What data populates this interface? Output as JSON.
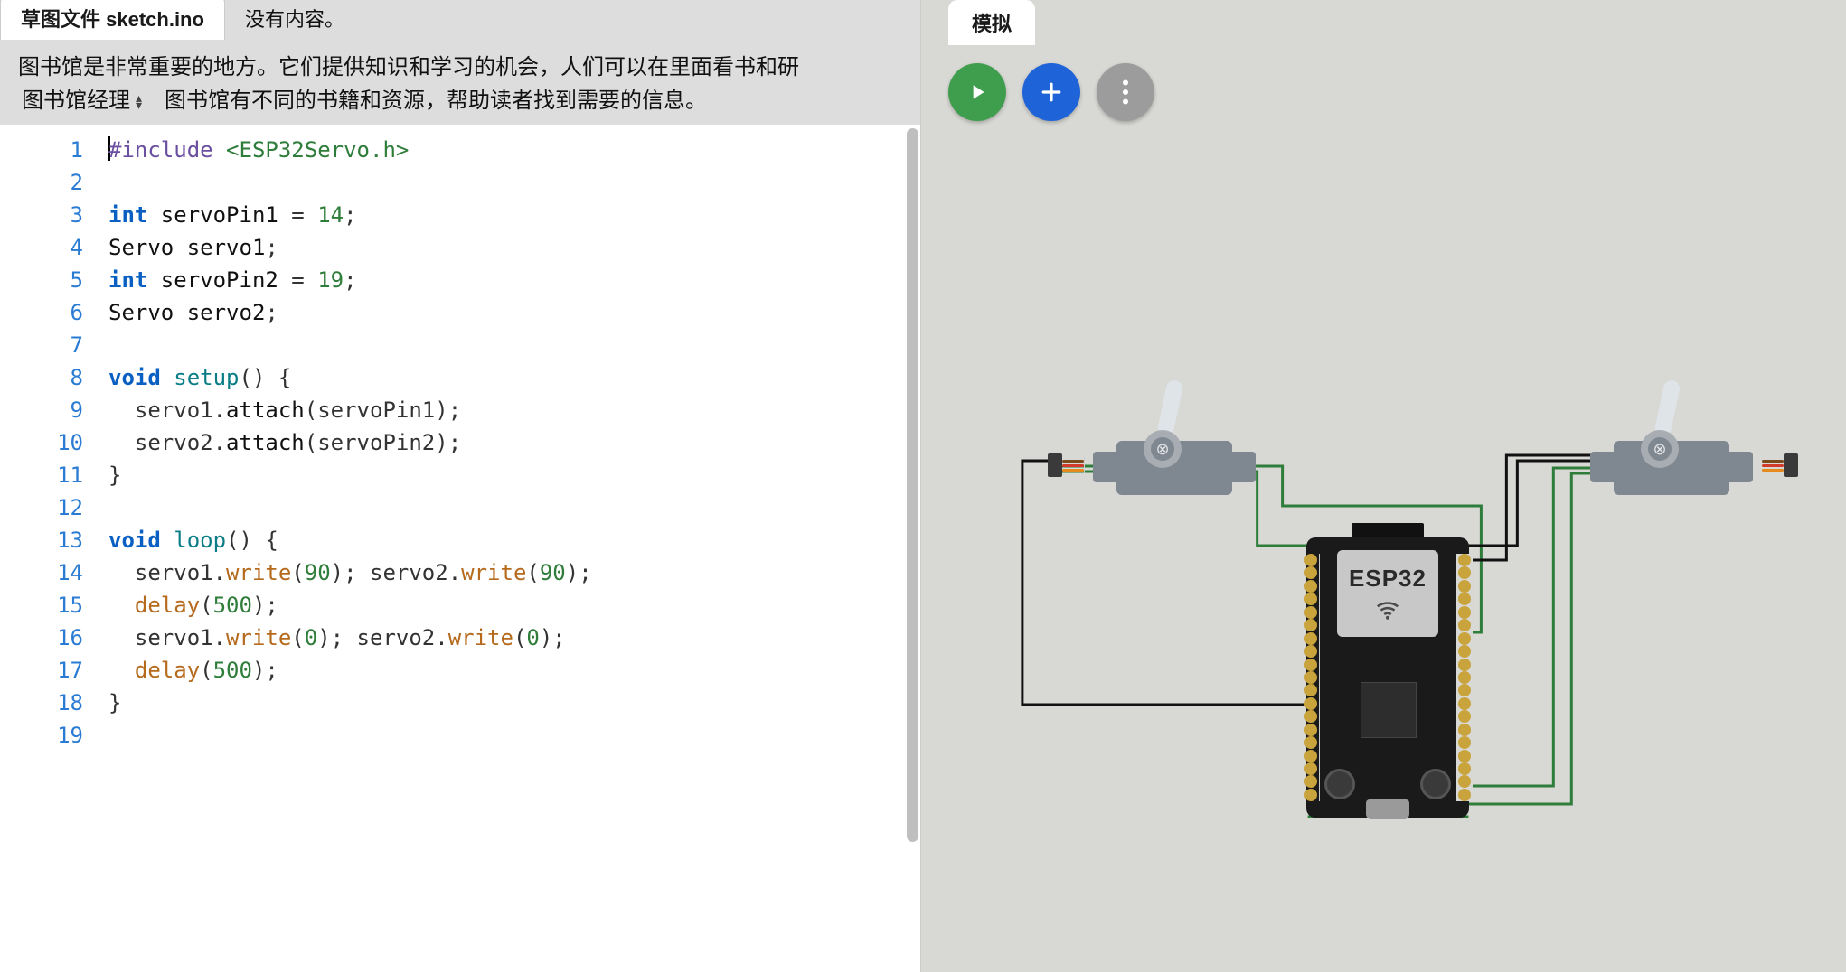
{
  "tabs": {
    "sketch_prefix": "草图文件 ",
    "sketch_filename": "sketch.ino",
    "empty_label": "没有内容。"
  },
  "description": {
    "line1": "图书馆是非常重要的地方。它们提供知识和学习的机会，人们可以在里面看书和研",
    "select_label": "图书馆经理",
    "line2_rest": "图书馆有不同的书籍和资源，帮助读者找到需要的信息。"
  },
  "editor": {
    "line_count": 19,
    "code_lines": [
      {
        "n": 1,
        "tokens": [
          [
            "pp",
            "#include "
          ],
          [
            "incstr",
            "<ESP32Servo.h>"
          ]
        ]
      },
      {
        "n": 2,
        "tokens": []
      },
      {
        "n": 3,
        "tokens": [
          [
            "kw",
            "int "
          ],
          [
            "type",
            "servoPin1 "
          ],
          [
            "pun",
            "= "
          ],
          [
            "num",
            "14"
          ],
          [
            "pun",
            ";"
          ]
        ]
      },
      {
        "n": 4,
        "tokens": [
          [
            "type",
            "Servo servo1"
          ],
          [
            "pun",
            ";"
          ]
        ]
      },
      {
        "n": 5,
        "tokens": [
          [
            "kw",
            "int "
          ],
          [
            "type",
            "servoPin2 "
          ],
          [
            "pun",
            "= "
          ],
          [
            "num",
            "19"
          ],
          [
            "pun",
            ";"
          ]
        ]
      },
      {
        "n": 6,
        "tokens": [
          [
            "type",
            "Servo servo2"
          ],
          [
            "pun",
            ";"
          ]
        ]
      },
      {
        "n": 7,
        "tokens": []
      },
      {
        "n": 8,
        "tokens": [
          [
            "kw",
            "void "
          ],
          [
            "fn",
            "setup"
          ],
          [
            "pun",
            "() {"
          ]
        ]
      },
      {
        "n": 9,
        "tokens": [
          [
            "pun",
            "  servo1."
          ],
          [
            "type",
            "attach"
          ],
          [
            "pun",
            "(servoPin1);"
          ]
        ]
      },
      {
        "n": 10,
        "tokens": [
          [
            "pun",
            "  servo2."
          ],
          [
            "type",
            "attach"
          ],
          [
            "pun",
            "(servoPin2);"
          ]
        ]
      },
      {
        "n": 11,
        "tokens": [
          [
            "pun",
            "}"
          ]
        ]
      },
      {
        "n": 12,
        "tokens": []
      },
      {
        "n": 13,
        "tokens": [
          [
            "kw",
            "void "
          ],
          [
            "fn",
            "loop"
          ],
          [
            "pun",
            "() {"
          ]
        ]
      },
      {
        "n": 14,
        "tokens": [
          [
            "pun",
            "  servo1."
          ],
          [
            "mfn",
            "write"
          ],
          [
            "pun",
            "("
          ],
          [
            "num",
            "90"
          ],
          [
            "pun",
            "); servo2."
          ],
          [
            "mfn",
            "write"
          ],
          [
            "pun",
            "("
          ],
          [
            "num",
            "90"
          ],
          [
            "pun",
            ");"
          ]
        ]
      },
      {
        "n": 15,
        "tokens": [
          [
            "pun",
            "  "
          ],
          [
            "mfn",
            "delay"
          ],
          [
            "pun",
            "("
          ],
          [
            "num",
            "500"
          ],
          [
            "pun",
            ");"
          ]
        ]
      },
      {
        "n": 16,
        "tokens": [
          [
            "pun",
            "  servo1."
          ],
          [
            "mfn",
            "write"
          ],
          [
            "pun",
            "("
          ],
          [
            "num",
            "0"
          ],
          [
            "pun",
            "); servo2."
          ],
          [
            "mfn",
            "write"
          ],
          [
            "pun",
            "("
          ],
          [
            "num",
            "0"
          ],
          [
            "pun",
            ");"
          ]
        ]
      },
      {
        "n": 17,
        "tokens": [
          [
            "pun",
            "  "
          ],
          [
            "mfn",
            "delay"
          ],
          [
            "pun",
            "("
          ],
          [
            "num",
            "500"
          ],
          [
            "pun",
            ");"
          ]
        ]
      },
      {
        "n": 18,
        "tokens": [
          [
            "pun",
            "}"
          ]
        ]
      },
      {
        "n": 19,
        "tokens": []
      }
    ]
  },
  "sim": {
    "tab_label": "模拟",
    "board_label": "ESP32"
  },
  "colors": {
    "play": "#3f9e4e",
    "add": "#1e64d8",
    "more": "#9c9c9c",
    "wire_black": "#111111",
    "wire_green": "#2f7d3a"
  }
}
